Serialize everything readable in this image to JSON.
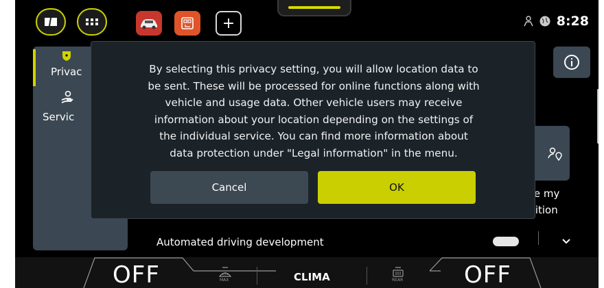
{
  "status_bar": {
    "time": "8:28"
  },
  "sidebar": {
    "items": [
      {
        "label": "Privac",
        "icon": "shield-icon"
      },
      {
        "label": "Servic",
        "icon": "service-hand-icon"
      }
    ]
  },
  "background": {
    "tile_text_line1": "re my",
    "tile_text_line2": "sition",
    "list_item_partial": "Automated driving development"
  },
  "modal": {
    "message_lines": [
      "By selecting this privacy setting, you will allow location data to",
      "be sent. These will be processed for online functions along with",
      "vehicle and usage data. Other vehicle users may receive",
      "information about your location depending on the settings of",
      "the individual service. You can find more information about",
      "data protection under \"Legal information\" in the menu."
    ],
    "cancel_label": "Cancel",
    "ok_label": "OK"
  },
  "climate": {
    "left_temp": "OFF",
    "center_label": "CLIMA",
    "right_temp": "OFF",
    "max_label": "MAX",
    "rear_label": "REAR"
  },
  "colors": {
    "accent": "#c9cf00",
    "panel": "#3b4752",
    "modal_bg": "#1b2329"
  }
}
